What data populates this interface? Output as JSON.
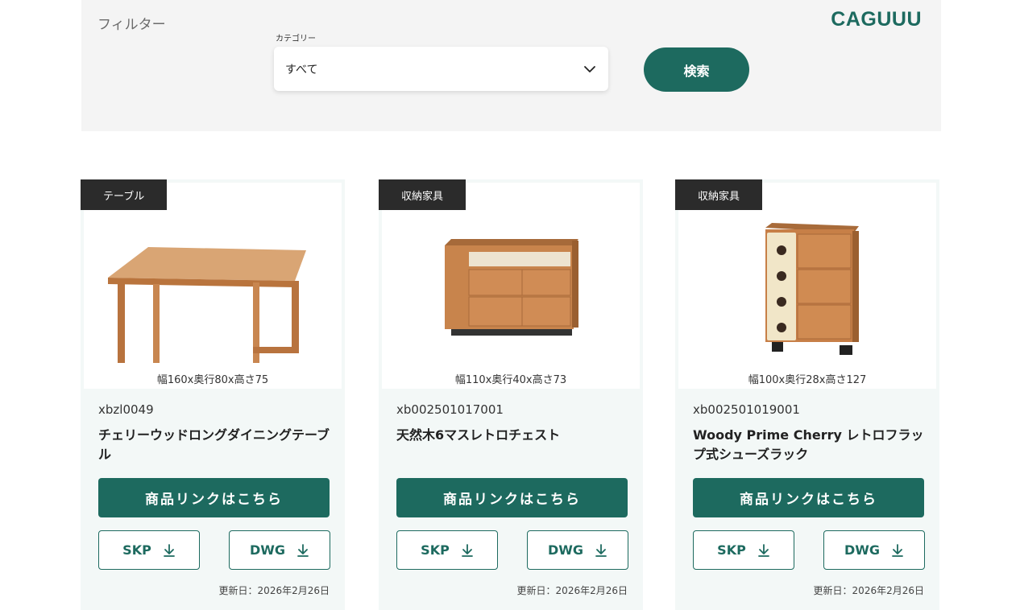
{
  "filter": {
    "title": "フィルター",
    "logo": "CAGUUU",
    "category_label": "カテゴリー",
    "category_value": "すべて",
    "search_label": "検索"
  },
  "colors": {
    "brand": "#1d6a5f",
    "badge": "#2b2b2b",
    "panel": "#f4f4f4",
    "card": "#f3f8f7"
  },
  "products": [
    {
      "badge": "テーブル",
      "dims": "幅160x奥行80x高さ75",
      "code": "xbzl0049",
      "name": "チェリーウッドロングダイニングテーブル",
      "link_label": "商品リンクはこちら",
      "skp_label": "SKP",
      "dwg_label": "DWG",
      "updated": "更新日：2026年2月26日",
      "image": "dining-table"
    },
    {
      "badge": "収納家具",
      "dims": "幅110x奥行40x高さ73",
      "code": "xb002501017001",
      "name": "天然木6マスレトロチェスト",
      "link_label": "商品リンクはこちら",
      "skp_label": "SKP",
      "dwg_label": "DWG",
      "updated": "更新日：2026年2月26日",
      "image": "chest-of-drawers"
    },
    {
      "badge": "収納家具",
      "dims": "幅100x奥行28x高さ127",
      "code": "xb002501019001",
      "name": "Woody Prime Cherry レトロフラップ式シューズラック",
      "link_label": "商品リンクはこちら",
      "skp_label": "SKP",
      "dwg_label": "DWG",
      "updated": "更新日：2026年2月26日",
      "image": "shoe-rack"
    }
  ]
}
